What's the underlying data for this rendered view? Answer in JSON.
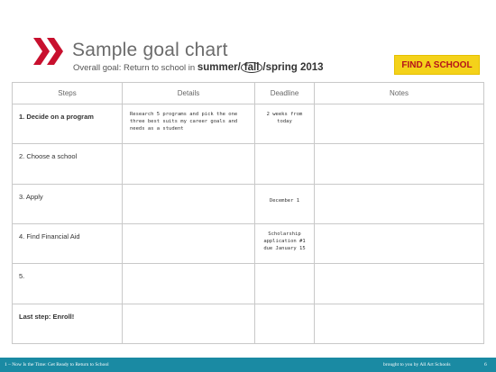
{
  "header": {
    "title": "Sample goal chart",
    "overall_goal_prefix": "Overall goal: Return to school in ",
    "season_summer": "summer",
    "season_sep1": "/",
    "season_fall": "fall",
    "season_sep2": "/",
    "season_spring_year": "spring 2013",
    "brand_color": "#c8102e"
  },
  "find_school_button": {
    "label": "FIND A SCHOOL",
    "bg": "#f4d21a",
    "fg": "#b5121b"
  },
  "table": {
    "columns": [
      "Steps",
      "Details",
      "Deadline",
      "Notes"
    ],
    "rows": [
      {
        "step": "1. Decide on a program",
        "details": "Research 5 programs and pick the one three best suits my career goals and needs as a student",
        "deadline": "2 weeks from today",
        "notes": ""
      },
      {
        "step": "2. Choose a school",
        "details": "",
        "deadline": "",
        "notes": ""
      },
      {
        "step": "3. Apply",
        "details": "",
        "deadline": "December 1",
        "notes": ""
      },
      {
        "step": "4. Find Financial Aid",
        "details": "",
        "deadline": "Scholarship application #1 due January 15",
        "notes": ""
      },
      {
        "step": "5.",
        "details": "",
        "deadline": "",
        "notes": ""
      },
      {
        "step": "Last step: Enroll!",
        "details": "",
        "deadline": "",
        "notes": ""
      }
    ]
  },
  "footer": {
    "left": "1 – Now Is the Time: Get Ready to Return to School",
    "right": "brought to you by All Art Schools",
    "page": "6",
    "bg": "#1a8aa3"
  }
}
